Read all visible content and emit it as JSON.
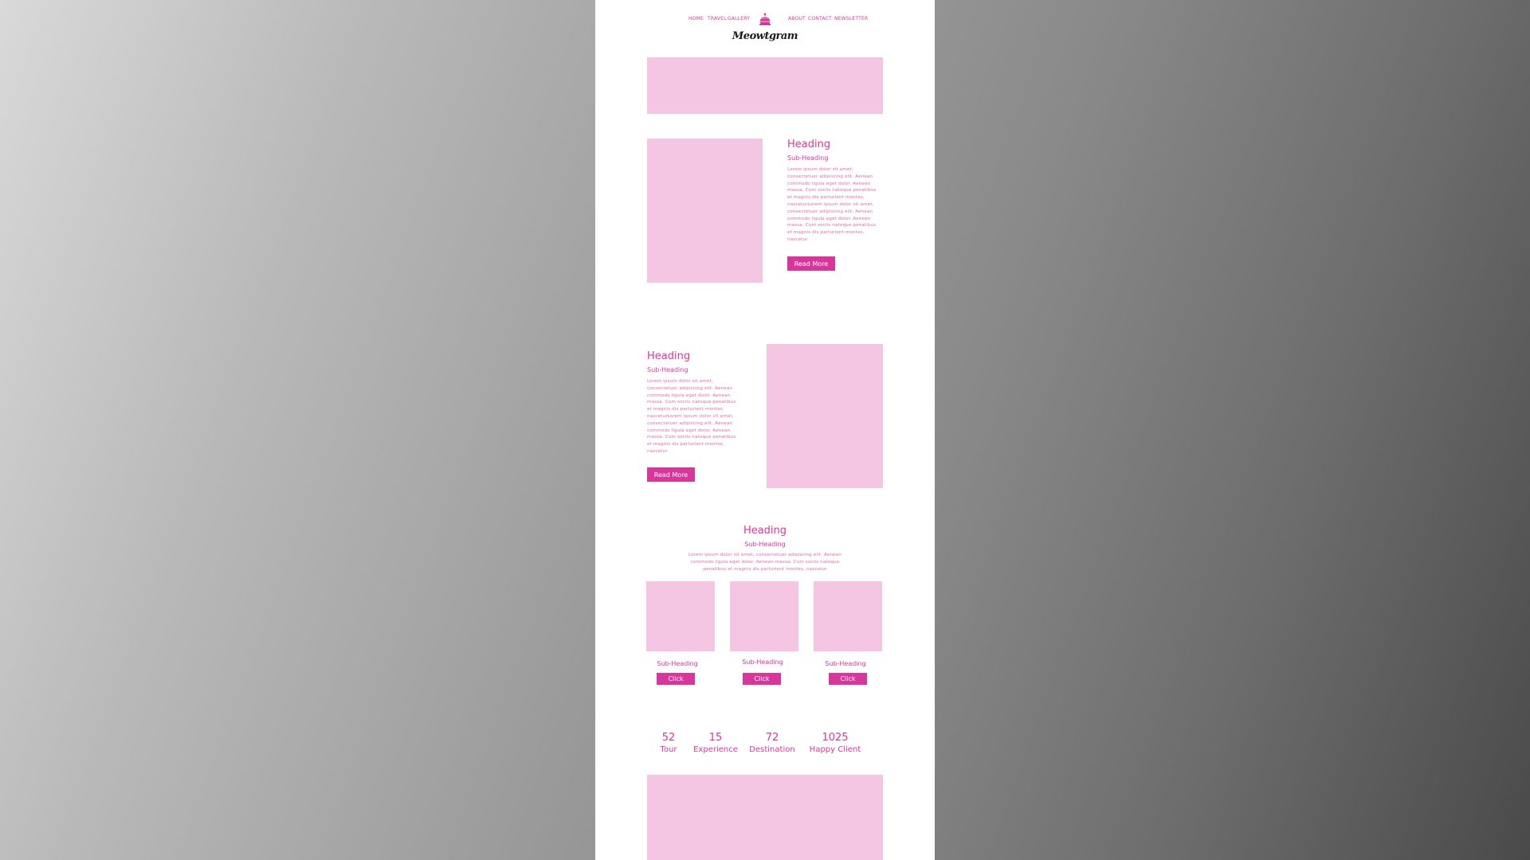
{
  "nav": {
    "left": [
      "HOME",
      "TRAVEL",
      "GALLERY"
    ],
    "right": [
      "ABOUT",
      "CONTACT",
      "NEWSLETTER"
    ],
    "brand": "Meowtgram",
    "logo_icon": "cake-icon"
  },
  "section1": {
    "heading": "Heading",
    "subheading": "Sub-Heading",
    "body": "Lorem ipsum dolor sit amet, consectetuer adipiscing elit. Aenean commodo ligula eget dolor. Aenean massa. Cum sociis natoque penatibus et magnis dis parturient montes, nasceturLorem ipsum dolor sit amet, consectetuer adipiscing elit. Aenean commodo ligula eget dolor. Aenean massa. Cum sociis natoque penatibus et magnis dis parturient montes, nascetur",
    "button": "Read More"
  },
  "section2": {
    "heading": "Heading",
    "subheading": "Sub-Heading",
    "body": "Lorem ipsum dolor sit amet, consectetuer adipiscing elit. Aenean commodo ligula eget dolor. Aenean massa. Cum sociis natoque penatibus et magnis dis parturient montes, nasceturLorem ipsum dolor sit amet, consectetuer adipiscing elit. Aenean commodo ligula eget dolor. Aenean massa. Cum sociis natoque penatibus et magnis dis parturient montes, nascetur",
    "button": "Read More"
  },
  "section3": {
    "heading": "Heading",
    "subheading": "Sub-Heading",
    "body": "Lorem ipsum dolor sit amet, consectetuer adipiscing elit. Aenean commodo ligula eget dolor. Aenean massa. Cum sociis natoque penatibus et magnis dis parturient montes, nascetur",
    "cards": [
      {
        "subheading": "Sub-Heading",
        "button": "Click"
      },
      {
        "subheading": "Sub-Heading",
        "button": "Click"
      },
      {
        "subheading": "Sub-Heading",
        "button": "Click"
      }
    ]
  },
  "stats": [
    {
      "number": "52",
      "label": "Tour"
    },
    {
      "number": "15",
      "label": "Experience"
    },
    {
      "number": "72",
      "label": "Destination"
    },
    {
      "number": "1025",
      "label": "Happy Client"
    }
  ],
  "colors": {
    "accent": "#d9369b",
    "placeholder": "#f4c6e3",
    "page": "#ffffff"
  }
}
